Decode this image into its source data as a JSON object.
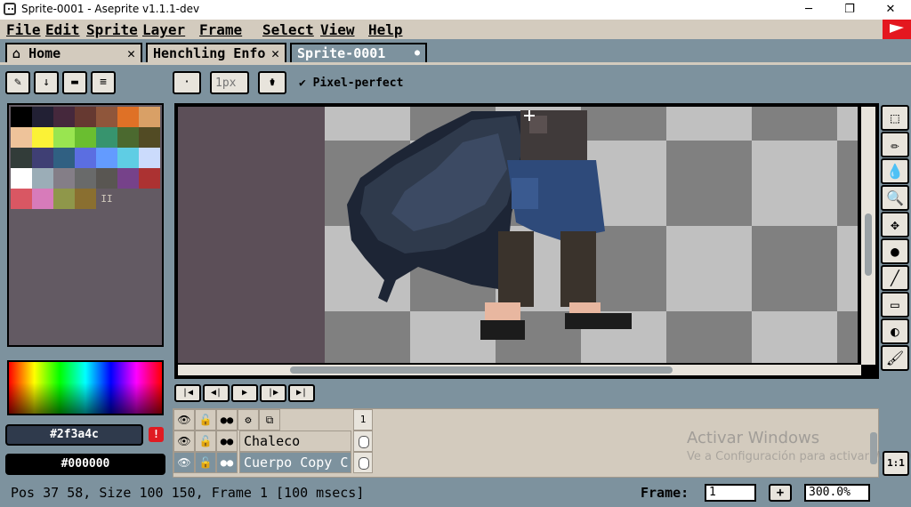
{
  "window": {
    "title": "Sprite-0001 - Aseprite v1.1.1-dev",
    "minimize": "─",
    "maximize": "❐",
    "close": "✕"
  },
  "menu": [
    "File",
    "Edit",
    "Sprite",
    "Layer",
    "Frame",
    "Select",
    "View",
    "Help"
  ],
  "tabs": [
    {
      "label": "Home",
      "close": "✕"
    },
    {
      "label": "Henchling Enfo",
      "close": "✕"
    },
    {
      "label": "Sprite-0001",
      "close": "●"
    }
  ],
  "toolbar": {
    "eraser": "✎",
    "down": "↓",
    "folder": "▬",
    "menu": "≡",
    "brush_type": "·",
    "brush_size_placeholder": "1px",
    "ink": "⚱",
    "pixel_perfect_check": "✔",
    "pixel_perfect_label": "Pixel-perfect"
  },
  "palette": {
    "colors": [
      "#000000",
      "#222034",
      "#45283c",
      "#663931",
      "#8f563b",
      "#df7126",
      "#d9a066",
      "#eec39a",
      "#fbf236",
      "#99e550",
      "#6abe30",
      "#37946e",
      "#4b692f",
      "#524b24",
      "#323c39",
      "#3f3f74",
      "#306082",
      "#5b6ee1",
      "#639bff",
      "#5fcde4",
      "#cbdbfc",
      "#ffffff",
      "#9badb7",
      "#847e87",
      "#696a6a",
      "#595652",
      "#76428a",
      "#ac3232",
      "#d95763",
      "#d77bba",
      "#8f974a",
      "#8a6f30"
    ],
    "extra": "II"
  },
  "colors": {
    "foreground_hex": "#2f3a4c",
    "background_hex": "#000000",
    "warning": "!"
  },
  "timeline": {
    "controls": [
      "|◀",
      "◀|",
      "▶",
      "|▶",
      "▶|"
    ],
    "header_icons": [
      "👁",
      "🔓",
      "●●",
      "⚙",
      "⧉"
    ],
    "frame_number": "1",
    "layers": [
      {
        "name": "Chaleco",
        "eye": "👁",
        "lock": "🔓",
        "cont": "●●"
      },
      {
        "name": "Cuerpo Copy C",
        "eye": "👁",
        "lock": "🔓",
        "cont": "●●"
      }
    ]
  },
  "right_tools": [
    "⬚",
    "✏",
    "💧",
    "🔍",
    "✥",
    "●",
    "╱",
    "▭",
    "◐",
    "🖌"
  ],
  "watermark": {
    "title": "Activar Windows",
    "subtitle": "Ve a Configuración para activar Windows."
  },
  "one_to_one": "1:1",
  "status": {
    "text": "Pos 37 58, Size 100 150, Frame 1 [100 msecs]",
    "frame_label": "Frame:",
    "frame_value": "1",
    "add": "+",
    "zoom": "300.0%"
  }
}
